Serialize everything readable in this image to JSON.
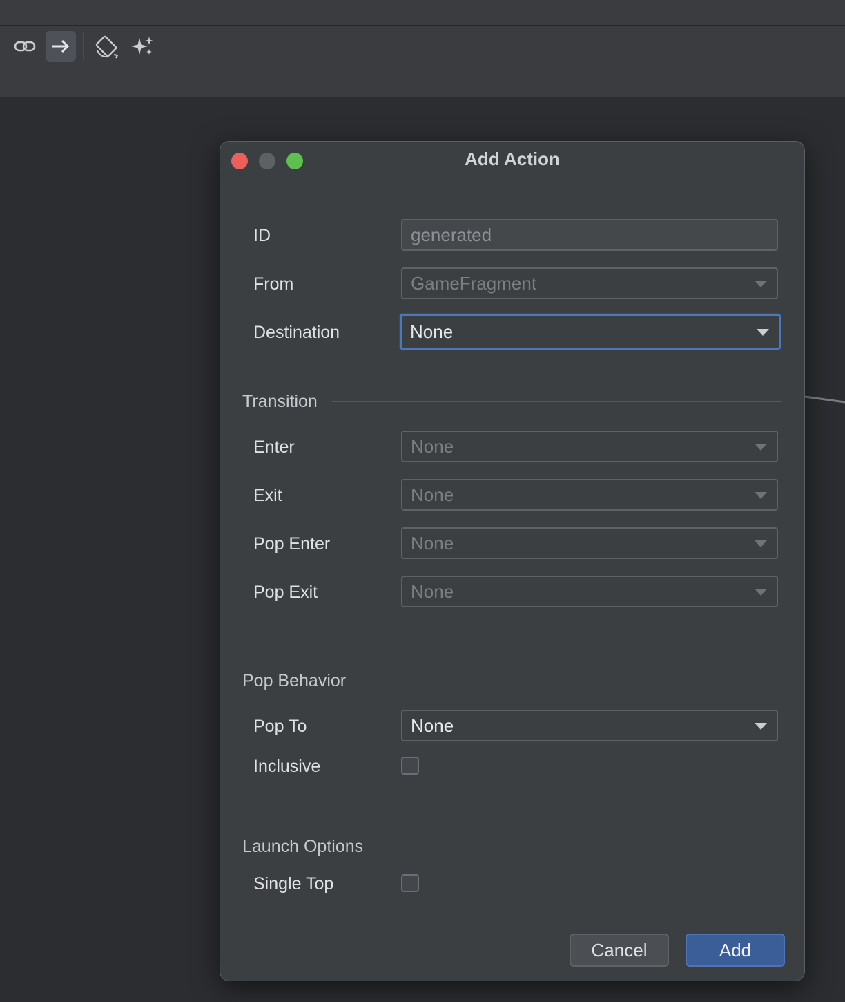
{
  "toolbar": {
    "icons": [
      "link-icon",
      "arrow-right-icon",
      "rotate-icon",
      "sparkle-icon"
    ]
  },
  "dialog": {
    "title": "Add Action",
    "id": {
      "label": "ID",
      "value": "generated"
    },
    "from": {
      "label": "From",
      "value": "GameFragment"
    },
    "destination": {
      "label": "Destination",
      "value": "None"
    },
    "transition": {
      "header": "Transition",
      "enter": {
        "label": "Enter",
        "value": "None"
      },
      "exit": {
        "label": "Exit",
        "value": "None"
      },
      "pop_enter": {
        "label": "Pop Enter",
        "value": "None"
      },
      "pop_exit": {
        "label": "Pop Exit",
        "value": "None"
      }
    },
    "pop_behavior": {
      "header": "Pop Behavior",
      "pop_to": {
        "label": "Pop To",
        "value": "None"
      },
      "inclusive": {
        "label": "Inclusive",
        "checked": false
      }
    },
    "launch_options": {
      "header": "Launch Options",
      "single_top": {
        "label": "Single Top",
        "checked": false
      }
    },
    "buttons": {
      "cancel": "Cancel",
      "add": "Add"
    }
  },
  "colors": {
    "accent": "#4a78b8",
    "primary_button": "#3b5e99",
    "close": "#ec5f5a",
    "zoom": "#5ec04f"
  }
}
